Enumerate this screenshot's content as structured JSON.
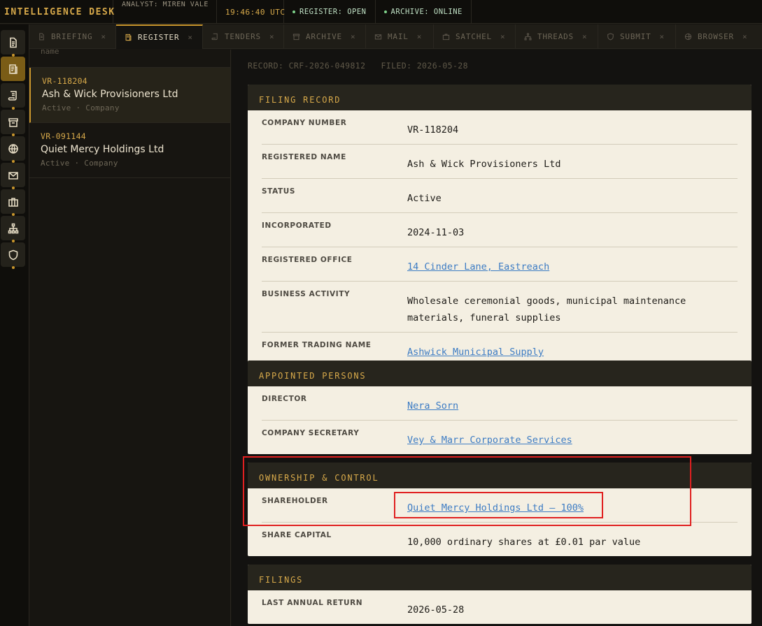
{
  "topbar": {
    "brand": "INTELLIGENCE DESK",
    "analyst": "ANALYST: MIREN VALE",
    "time": "19:46:40 UTC",
    "register_status": "REGISTER: OPEN",
    "archive_status": "ARCHIVE: ONLINE",
    "status_color": "#7fd38b"
  },
  "rail": [
    {
      "icon": "document-icon",
      "active": false
    },
    {
      "icon": "register-icon",
      "active": true
    },
    {
      "icon": "scroll-icon",
      "active": false
    },
    {
      "icon": "archive-icon",
      "active": false
    },
    {
      "icon": "globe-icon",
      "active": false
    },
    {
      "icon": "mail-icon",
      "active": false
    },
    {
      "icon": "briefcase-icon",
      "active": false
    },
    {
      "icon": "network-icon",
      "active": false
    },
    {
      "icon": "shield-icon",
      "active": false
    }
  ],
  "tabs": [
    {
      "label": "BRIEFING",
      "icon": "document-icon"
    },
    {
      "label": "REGISTER",
      "icon": "register-icon",
      "active": true
    },
    {
      "label": "TENDERS",
      "icon": "scroll-icon"
    },
    {
      "label": "ARCHIVE",
      "icon": "archive-icon"
    },
    {
      "label": "MAIL",
      "icon": "mail-icon"
    },
    {
      "label": "SATCHEL",
      "icon": "briefcase-icon"
    },
    {
      "label": "THREADS",
      "icon": "network-icon"
    },
    {
      "label": "SUBMIT",
      "icon": "shield-icon"
    },
    {
      "label": "BROWSER",
      "icon": "globe-icon"
    }
  ],
  "tab_close": "×",
  "list": {
    "header_partial": "name",
    "items": [
      {
        "id": "VR-118204",
        "name": "Ash & Wick Provisioners Ltd",
        "meta": "Active · Company",
        "active": true
      },
      {
        "id": "VR-091144",
        "name": "Quiet Mercy Holdings Ltd",
        "meta": "Active · Company",
        "active": false
      }
    ]
  },
  "record": {
    "record_no": "RECORD: CRF-2026-049812",
    "filed": "FILED: 2026-05-28"
  },
  "filing_record": {
    "title": "FILING RECORD",
    "rows": [
      {
        "label": "COMPANY NUMBER",
        "value": "VR-118204"
      },
      {
        "label": "REGISTERED NAME",
        "value": "Ash & Wick Provisioners Ltd"
      },
      {
        "label": "STATUS",
        "value": "Active"
      },
      {
        "label": "INCORPORATED",
        "value": "2024-11-03"
      },
      {
        "label": "REGISTERED OFFICE",
        "value": "14 Cinder Lane, Eastreach"
      },
      {
        "label": "BUSINESS ACTIVITY",
        "value": "Wholesale ceremonial goods, municipal maintenance materials, funeral supplies"
      },
      {
        "label": "FORMER TRADING NAME",
        "value": "Ashwick Municipal Supply"
      }
    ]
  },
  "appointed_persons": {
    "title": "APPOINTED PERSONS",
    "rows": [
      {
        "label": "DIRECTOR",
        "value": "Nera Sorn"
      },
      {
        "label": "COMPANY SECRETARY",
        "value": "Vey & Marr Corporate Services"
      }
    ]
  },
  "ownership": {
    "title": "OWNERSHIP & CONTROL",
    "rows": [
      {
        "label": "SHAREHOLDER",
        "value": "Quiet Mercy Holdings Ltd — 100%"
      },
      {
        "label": "SHARE CAPITAL",
        "value": "10,000 ordinary shares at £0.01 par value"
      }
    ]
  },
  "filings": {
    "title": "FILINGS",
    "rows": [
      {
        "label": "LAST ANNUAL RETURN",
        "value": "2026-05-28"
      }
    ]
  },
  "colors": {
    "accent": "#d7a94a",
    "link": "#3d7cc4",
    "highlight": "#e02020"
  }
}
